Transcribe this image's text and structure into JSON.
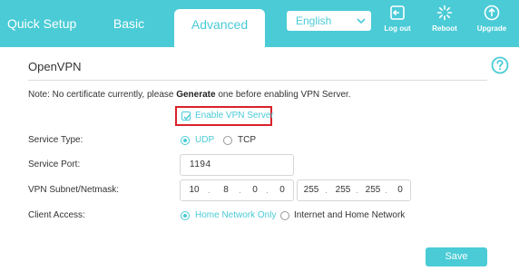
{
  "nav": {
    "tabs": [
      {
        "label": "Quick Setup"
      },
      {
        "label": "Basic"
      },
      {
        "label": "Advanced",
        "active": true
      }
    ],
    "language": {
      "selected": "English"
    },
    "actions": [
      {
        "label": "Log out",
        "icon": "logout-icon"
      },
      {
        "label": "Reboot",
        "icon": "reboot-icon"
      },
      {
        "label": "Upgrade",
        "icon": "upgrade-icon"
      }
    ]
  },
  "colors": {
    "accent": "#4acbd6",
    "highlight": "#d8222a"
  },
  "section": {
    "title": "OpenVPN",
    "help_icon": "help-icon"
  },
  "note": {
    "prefix": "Note: No certificate currently, please ",
    "emphasis": "Generate",
    "suffix": " one before enabling VPN Server."
  },
  "enable_vpn": {
    "label": "Enable VPN Server",
    "checked": true
  },
  "service_type": {
    "label": "Service Type:",
    "options": [
      {
        "label": "UDP",
        "selected": true
      },
      {
        "label": "TCP",
        "selected": false
      }
    ]
  },
  "service_port": {
    "label": "Service Port:",
    "value": "1194"
  },
  "subnet": {
    "label": "VPN Subnet/Netmask:",
    "ip": [
      "10",
      "8",
      "0",
      "0"
    ],
    "mask": [
      "255",
      "255",
      "255",
      "0"
    ]
  },
  "client_access": {
    "label": "Client Access:",
    "options": [
      {
        "label": "Home Network Only",
        "selected": true
      },
      {
        "label": "Internet and Home Network",
        "selected": false
      }
    ]
  },
  "save_label": "Save"
}
